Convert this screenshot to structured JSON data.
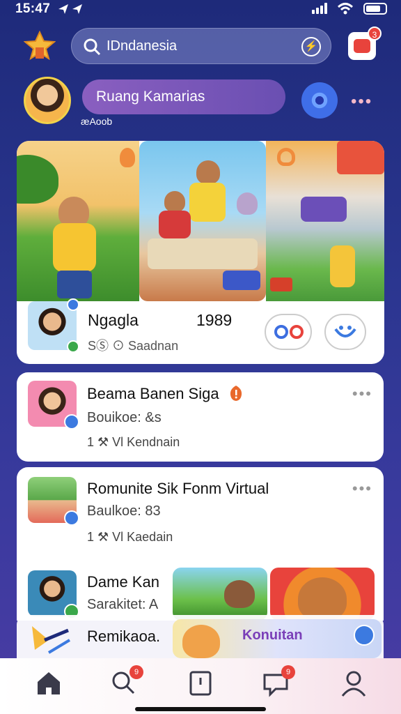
{
  "status_bar": {
    "time": "15:47"
  },
  "header": {
    "search_text": "IDndanesia",
    "notification_count": "3"
  },
  "profile": {
    "community_label": "Ruang Kamarias",
    "handle": "æAoob"
  },
  "hero": {
    "title": "Ngagla",
    "year": "1989",
    "meta": "SⓈ ⊙ Saadnan"
  },
  "list": [
    {
      "title": "Beama Banen Siga",
      "subtitle": "Bouikoe: &s",
      "meta": "1 ⚒ Vl Kendnain"
    },
    {
      "title": "Romunite Sik Fonm Virtual",
      "subtitle": "Baulkoe: 83",
      "meta": "1 ⚒ Vl Kaedain"
    },
    {
      "title": "Dame Kan",
      "subtitle": "Sarakitet: A",
      "tile_label": "Konuitan"
    },
    {
      "title": "Remikaoa."
    }
  ],
  "bottom_nav": {
    "items": [
      "home-tab",
      "search-tab",
      "add-tab",
      "chat-tab",
      "profile-tab"
    ],
    "search_badge": "9",
    "chat_badge": "9"
  },
  "colors": {
    "accent": "#3c7ae0",
    "badge": "#e8433c",
    "background": "#2b3690"
  }
}
